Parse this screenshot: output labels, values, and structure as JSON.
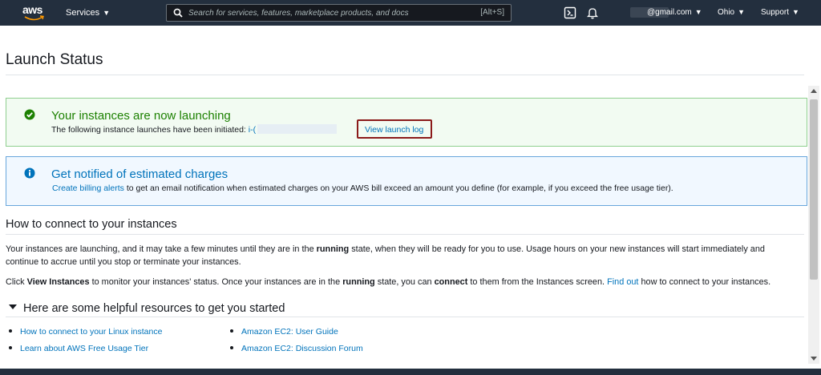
{
  "nav": {
    "logo": "aws",
    "services": "Services",
    "search_placeholder": "Search for services, features, marketplace products, and docs",
    "search_shortcut": "[Alt+S]",
    "account": "@gmail.com",
    "region": "Ohio",
    "support": "Support",
    "icons": [
      "cloudshell-icon",
      "bell-icon"
    ]
  },
  "page": {
    "title": "Launch Status"
  },
  "success_alert": {
    "title": "Your instances are now launching",
    "body": "The following instance launches have been initiated:",
    "instance_prefix": "i-(",
    "view_log": "View launch log",
    "color": "#1d8102"
  },
  "info_alert": {
    "title": "Get notified of estimated charges",
    "link": "Create billing alerts",
    "body": "to get an email notification when estimated charges on your AWS bill exceed an amount you define (for example, if you exceed the free usage tier).",
    "color": "#0073bb"
  },
  "connect": {
    "heading": "How to connect to your instances",
    "p1_a": "Your instances are launching, and it may take a few minutes until they are in the",
    "p1_b": "running",
    "p1_c": "state, when they will be ready for you to use. Usage hours on your new instances will start immediately and continue to accrue until you stop or terminate your instances.",
    "p2_a": "Click",
    "p2_b": "View Instances",
    "p2_c": "to monitor your instances' status. Once your instances are in the",
    "p2_d": "running",
    "p2_e": "state, you can",
    "p2_f": "connect",
    "p2_g": "to them from the Instances screen.",
    "p2_link": "Find out",
    "p2_h": "how to connect to your instances."
  },
  "resources": {
    "heading": "Here are some helpful resources to get you started",
    "left": [
      "How to connect to your Linux instance",
      "Learn about AWS Free Usage Tier"
    ],
    "right": [
      "Amazon EC2: User Guide",
      "Amazon EC2: Discussion Forum"
    ]
  }
}
